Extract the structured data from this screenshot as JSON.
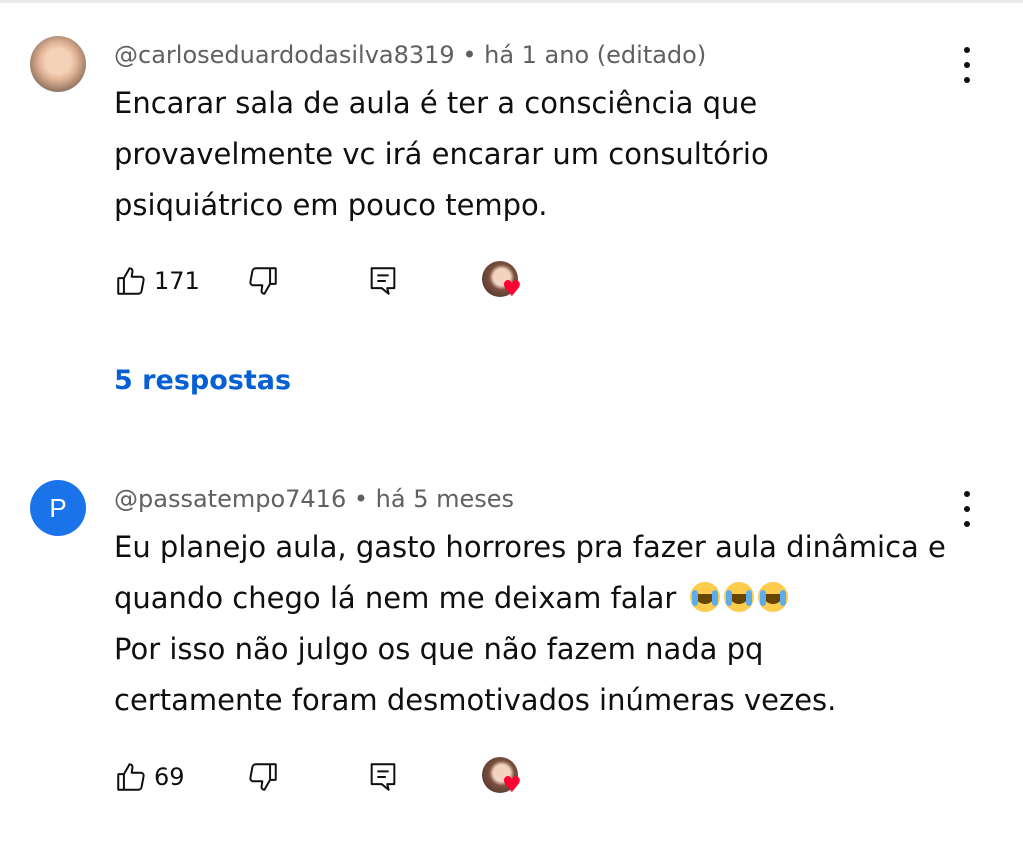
{
  "comments": [
    {
      "author": "@carloseduardodasilva8319",
      "time": "há 1 ano (editado)",
      "lines": [
        "Encarar sala de aula é ter a consciência que",
        "provavelmente vc irá encarar um consultório",
        "psiquiátrico em pouco tempo."
      ],
      "likes": "171",
      "replies_label": "5 respostas",
      "avatar_type": "photo"
    },
    {
      "author": "@passatempo7416",
      "avatar_letter": "P",
      "time": "há 5 meses",
      "lines": [
        "Eu planejo aula, gasto horrores pra fazer aula dinâmica e",
        "quando chego lá nem me deixam falar",
        "Por isso não julgo os que não fazem nada pq",
        "certamente foram desmotivados inúmeras vezes."
      ],
      "emoji_count": 3,
      "emoji_name": "loudly-crying-face",
      "likes": "69",
      "avatar_type": "letter"
    }
  ],
  "meta_separator": " • ",
  "icons": {
    "like": "thumb-up-icon",
    "dislike": "thumb-down-icon",
    "reply": "reply-comment-icon",
    "creator_heart": "creator-heart-icon",
    "more": "more-vert-icon"
  },
  "colors": {
    "link_blue": "#065fd4",
    "meta_gray": "#606060",
    "heart_red": "#ff0033",
    "avatar_blue": "#1a73e8"
  }
}
